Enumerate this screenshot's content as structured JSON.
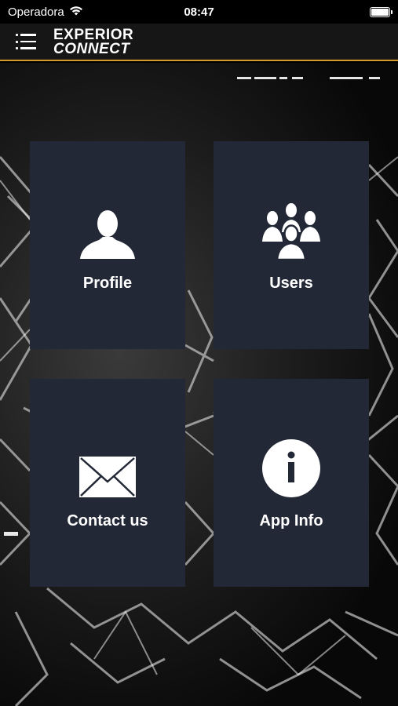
{
  "status_bar": {
    "carrier": "Operadora",
    "time": "08:47",
    "wifi_icon": "wifi-icon",
    "battery_icon": "battery-icon"
  },
  "nav_bar": {
    "menu_icon": "menu-icon",
    "logo_line1": "EXPERIOR",
    "logo_line2": "CONNECT",
    "accent_color": "#d49a2a"
  },
  "tiles": [
    {
      "label": "Profile",
      "icon": "person-icon"
    },
    {
      "label": "Users",
      "icon": "users-icon"
    },
    {
      "label": "Contact us",
      "icon": "envelope-icon"
    },
    {
      "label": "App Info",
      "icon": "info-icon"
    }
  ],
  "colors": {
    "tile_background": "#232836",
    "page_background": "#000000"
  }
}
